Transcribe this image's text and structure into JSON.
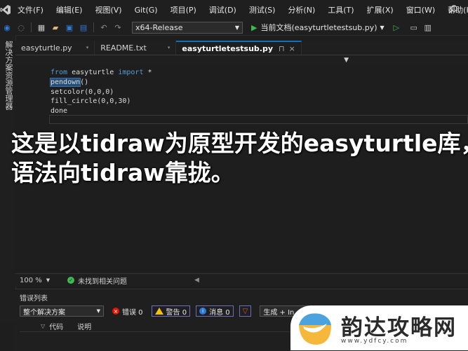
{
  "menu": [
    "文件(F)",
    "编辑(E)",
    "视图(V)",
    "Git(G)",
    "项目(P)",
    "调试(D)",
    "测试(S)",
    "分析(N)",
    "工具(T)",
    "扩展(X)",
    "窗口(W)",
    "帮助(H)"
  ],
  "toolbar": {
    "config": "x64-Release",
    "run_label": "当前文档(easyturtletestsub.py)"
  },
  "sidebar": {
    "label": "解决方案资源管理器"
  },
  "tabs": [
    {
      "label": "easyturtle.py"
    },
    {
      "label": "README.txt"
    },
    {
      "label": "easyturtletestsub.py",
      "pin": "⊓",
      "close": "×"
    }
  ],
  "code": {
    "line1_kw1": "from",
    "line1_mod": " easyturtle ",
    "line1_kw2": "import",
    "line1_rest": " *",
    "line2_hl": "pendown",
    "line2_rest": "()",
    "line3": "setcolor(0,0,0)",
    "line4": "fill_circle(0,0,30)",
    "line5": "done"
  },
  "subtitle": {
    "line1": "这是以tidraw为原型开发的easyturtle库，",
    "line2": "语法向tidraw靠拢。"
  },
  "statusbar": {
    "zoom": "100 %",
    "issues": "未找到相关问题"
  },
  "error_list": {
    "title": "错误列表",
    "scope": "整个解决方案",
    "errors": "错误 0",
    "warnings": "警告 0",
    "messages": "消息 0",
    "build": "生成 + In",
    "col_code": "代码",
    "col_desc": "说明"
  },
  "watermark": {
    "text": "韵达攻略网",
    "url": "www.ydfcy.com"
  }
}
